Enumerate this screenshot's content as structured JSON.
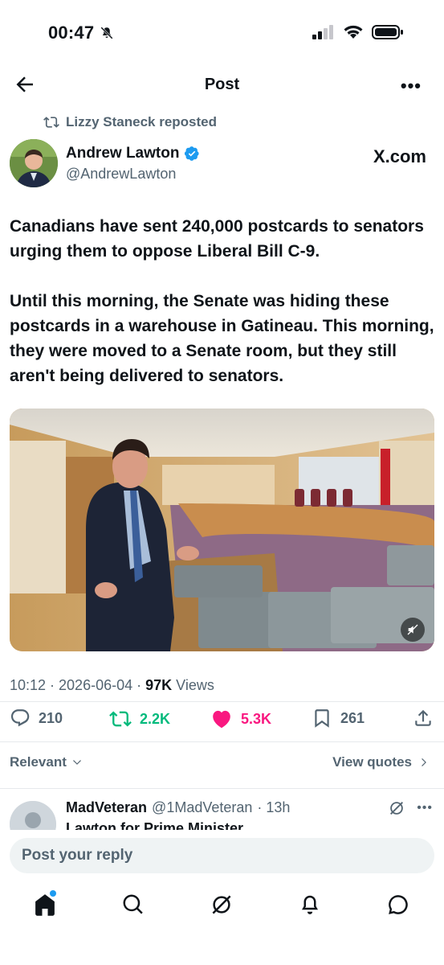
{
  "status": {
    "time": "00:47"
  },
  "nav": {
    "title": "Post"
  },
  "repost": {
    "label": "Lizzy Staneck reposted"
  },
  "author": {
    "name": "Andrew Lawton",
    "handle": "@AndrewLawton",
    "source": "X.com"
  },
  "tweet": {
    "paragraph1": "Canadians have sent 240,000 postcards to senators urging them to oppose Liberal Bill C-9.",
    "paragraph2": "Until this morning, the Senate was hiding these postcards in a warehouse in Gatineau. This morning, they were moved to a Senate room, but they still aren't being delivered to senators."
  },
  "meta": {
    "timestamp": "10:12 · 2026-06-04 · ",
    "views_count": "97K",
    "views_label": " Views"
  },
  "actions": {
    "replies": "210",
    "reposts": "2.2K",
    "likes": "5.3K",
    "bookmarks": "261"
  },
  "filters": {
    "sort": "Relevant",
    "view_quotes": "View quotes"
  },
  "reply": {
    "name": "MadVeteran",
    "handle": "@1MadVeteran",
    "time": "· 13h",
    "text": "Lawton for Prime Minister"
  },
  "compose": {
    "placeholder": "Post your reply"
  },
  "colors": {
    "accent": "#1d9bf0",
    "repost_green": "#00ba7c",
    "like_pink": "#f91880",
    "text": "#0f1419",
    "muted": "#536471"
  }
}
